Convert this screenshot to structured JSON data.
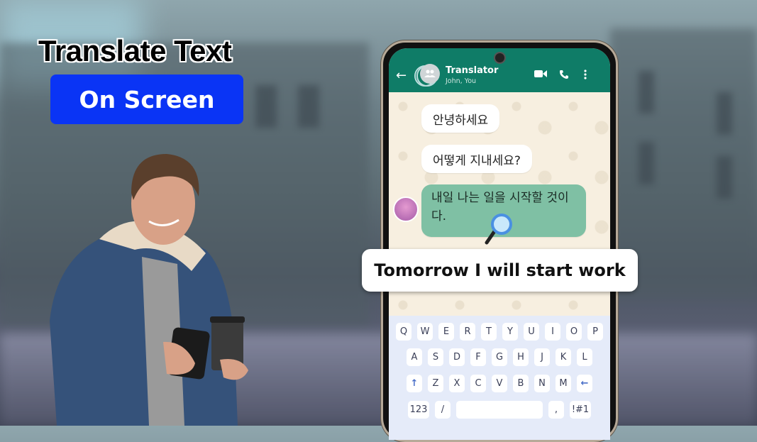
{
  "promo": {
    "headline": "Translate Text",
    "pill_label": "On Screen",
    "accent_color": "#0a34f5"
  },
  "phone": {
    "appbar": {
      "back_icon": "arrow-left-icon",
      "group_title": "Translator",
      "group_members": "John, You",
      "actions": [
        "video-call-icon",
        "phone-icon",
        "more-vert-icon"
      ],
      "color": "#0f7c67"
    },
    "chat": {
      "messages": [
        {
          "text": "안녕하세요",
          "style": "incoming"
        },
        {
          "text": "어떻게 지내세요?",
          "style": "incoming"
        },
        {
          "text": "내일 나는 일을 시작할 것이다.",
          "style": "highlighted"
        }
      ],
      "highlight_color": "#7fc0a4"
    },
    "keyboard": {
      "row1": [
        "Q",
        "W",
        "E",
        "R",
        "T",
        "Y",
        "U",
        "I",
        "O",
        "P"
      ],
      "row2": [
        "A",
        "S",
        "D",
        "F",
        "G",
        "H",
        "J",
        "K",
        "L"
      ],
      "row3": [
        "↑",
        "Z",
        "X",
        "C",
        "V",
        "B",
        "N",
        "M",
        "←"
      ],
      "row4": {
        "numbers": "123",
        "slash": "/",
        "comma": ",",
        "symbols": "!#1"
      }
    }
  },
  "translation": {
    "text": "Tomorrow I will start work"
  }
}
